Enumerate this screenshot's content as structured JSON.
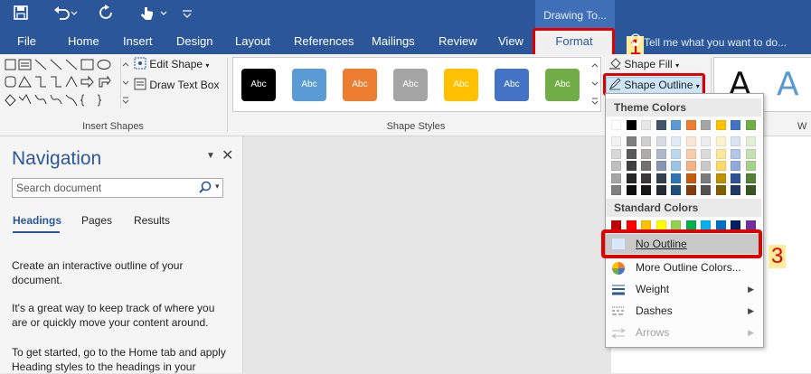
{
  "titlebar": {
    "context_tab_group": "Drawing To...",
    "tell_me_placeholder": "Tell me what you want to do..."
  },
  "tabs": [
    "File",
    "Home",
    "Insert",
    "Design",
    "Layout",
    "References",
    "Mailings",
    "Review",
    "View"
  ],
  "format_tab": "Format",
  "ribbon": {
    "edit_shape": "Edit Shape",
    "draw_text_box": "Draw Text Box",
    "insert_shapes_label": "Insert Shapes",
    "shape_styles_label": "Shape Styles",
    "shape_fill": "Shape Fill",
    "shape_outline": "Shape Outline",
    "style_text": "Abc",
    "big_letter": "A",
    "wordart_label_partial": "W",
    "style_colors": [
      "#000000",
      "#5b9bd5",
      "#ed7d31",
      "#a5a5a5",
      "#ffc000",
      "#4472c4",
      "#70ad47"
    ]
  },
  "callouts": [
    "1",
    "2",
    "3"
  ],
  "navigation": {
    "title": "Navigation",
    "search_placeholder": "Search document",
    "tabs": [
      "Headings",
      "Pages",
      "Results"
    ],
    "para1": "Create an interactive outline of your document.",
    "para2": "It's a great way to keep track of where you are or quickly move your content around.",
    "para3": "To get started, go to the Home tab and apply Heading styles to the headings in your"
  },
  "dropdown": {
    "theme_colors_label": "Theme Colors",
    "standard_colors_label": "Standard Colors",
    "theme_top": [
      "#ffffff",
      "#000000",
      "#e7e6e6",
      "#44546a",
      "#5b9bd5",
      "#ed7d31",
      "#a5a5a5",
      "#ffc000",
      "#4472c4",
      "#70ad47"
    ],
    "theme_shades": [
      [
        "#f2f2f2",
        "#7f7f7f",
        "#d0cece",
        "#d6dce4",
        "#deebf6",
        "#fbe5d5",
        "#ededed",
        "#fff2cc",
        "#dae3f3",
        "#e2efd9"
      ],
      [
        "#d8d8d8",
        "#595959",
        "#aeabab",
        "#adb9ca",
        "#bdd7ee",
        "#f7cbac",
        "#dbdbdb",
        "#fee599",
        "#b4c6e7",
        "#c5e0b3"
      ],
      [
        "#bfbfbf",
        "#3f3f3f",
        "#757070",
        "#8496b0",
        "#9dc3e6",
        "#f4b183",
        "#c9c9c9",
        "#ffd965",
        "#8eaadb",
        "#a8d08d"
      ],
      [
        "#a5a5a5",
        "#262626",
        "#3a3838",
        "#323f4f",
        "#2e75b5",
        "#c55a11",
        "#7b7b7b",
        "#bf9000",
        "#2f5496",
        "#538135"
      ],
      [
        "#7f7f7f",
        "#0c0c0c",
        "#171616",
        "#222a35",
        "#1e4e79",
        "#833c0b",
        "#525252",
        "#7f6000",
        "#1f3864",
        "#375623"
      ]
    ],
    "standard": [
      "#c00000",
      "#ff0000",
      "#ffc000",
      "#ffff00",
      "#92d050",
      "#00b050",
      "#00b0f0",
      "#0070c0",
      "#002060",
      "#7030a0"
    ],
    "items": [
      "No Outline",
      "More Outline Colors...",
      "Weight",
      "Dashes",
      "Arrows"
    ]
  }
}
